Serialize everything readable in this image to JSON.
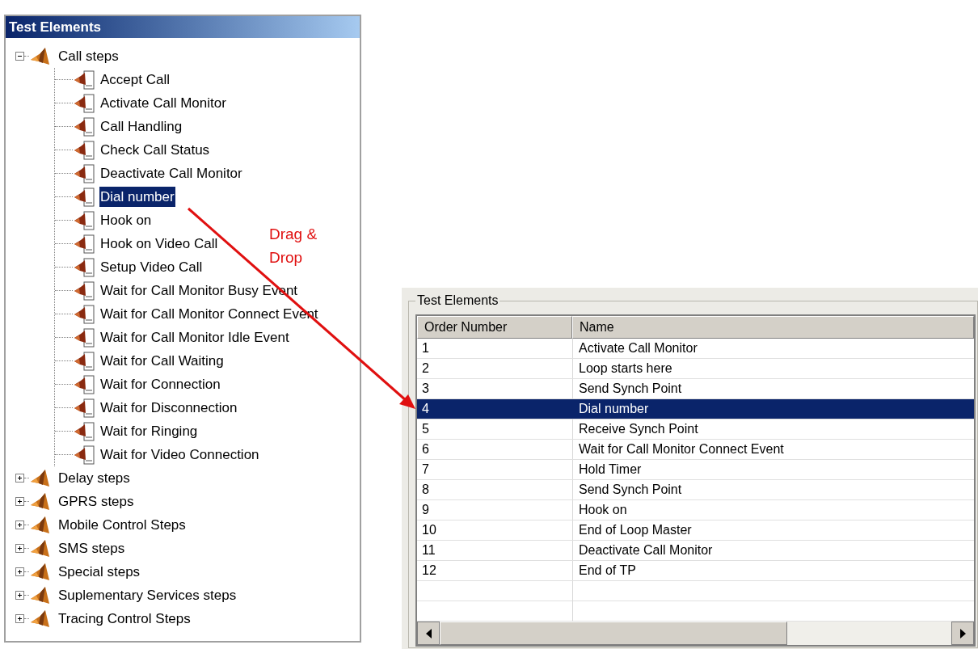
{
  "tree_panel": {
    "title": "Test Elements",
    "items": [
      {
        "label": "Call steps",
        "expanded": true,
        "children": [
          {
            "label": "Accept Call",
            "selected": false
          },
          {
            "label": "Activate Call Monitor",
            "selected": false
          },
          {
            "label": "Call Handling",
            "selected": false
          },
          {
            "label": "Check Call Status",
            "selected": false
          },
          {
            "label": "Deactivate Call Monitor",
            "selected": false
          },
          {
            "label": "Dial number",
            "selected": true
          },
          {
            "label": "Hook on",
            "selected": false
          },
          {
            "label": "Hook on Video Call",
            "selected": false
          },
          {
            "label": "Setup Video Call",
            "selected": false
          },
          {
            "label": "Wait for Call Monitor Busy Event",
            "selected": false
          },
          {
            "label": "Wait for Call Monitor Connect Event",
            "selected": false
          },
          {
            "label": "Wait for Call Monitor Idle Event",
            "selected": false
          },
          {
            "label": "Wait for Call Waiting",
            "selected": false
          },
          {
            "label": "Wait for Connection",
            "selected": false
          },
          {
            "label": "Wait for Disconnection",
            "selected": false
          },
          {
            "label": "Wait for Ringing",
            "selected": false
          },
          {
            "label": "Wait for Video Connection",
            "selected": false
          }
        ]
      },
      {
        "label": "Delay steps",
        "expanded": false
      },
      {
        "label": "GPRS steps",
        "expanded": false
      },
      {
        "label": "Mobile Control Steps",
        "expanded": false
      },
      {
        "label": "SMS steps",
        "expanded": false
      },
      {
        "label": "Special steps",
        "expanded": false
      },
      {
        "label": "Suplementary Services steps",
        "expanded": false
      },
      {
        "label": "Tracing Control Steps",
        "expanded": false
      }
    ]
  },
  "annotation": {
    "label": "Drag & Drop"
  },
  "list_panel": {
    "legend": "Test Elements",
    "columns": [
      "Order Number",
      "Name"
    ],
    "rows": [
      {
        "order": "1",
        "name": "Activate Call Monitor",
        "selected": false
      },
      {
        "order": "2",
        "name": "Loop starts here",
        "selected": false
      },
      {
        "order": "3",
        "name": "Send Synch Point",
        "selected": false
      },
      {
        "order": "4",
        "name": "Dial number",
        "selected": true
      },
      {
        "order": "5",
        "name": "Receive Synch Point",
        "selected": false
      },
      {
        "order": "6",
        "name": "Wait for Call Monitor Connect Event",
        "selected": false
      },
      {
        "order": "7",
        "name": "Hold Timer",
        "selected": false
      },
      {
        "order": "8",
        "name": "Send Synch Point",
        "selected": false
      },
      {
        "order": "9",
        "name": "Hook on",
        "selected": false
      },
      {
        "order": "10",
        "name": "End of Loop Master",
        "selected": false
      },
      {
        "order": "11",
        "name": "Deactivate Call Monitor",
        "selected": false
      },
      {
        "order": "12",
        "name": "End of TP",
        "selected": false
      }
    ]
  }
}
